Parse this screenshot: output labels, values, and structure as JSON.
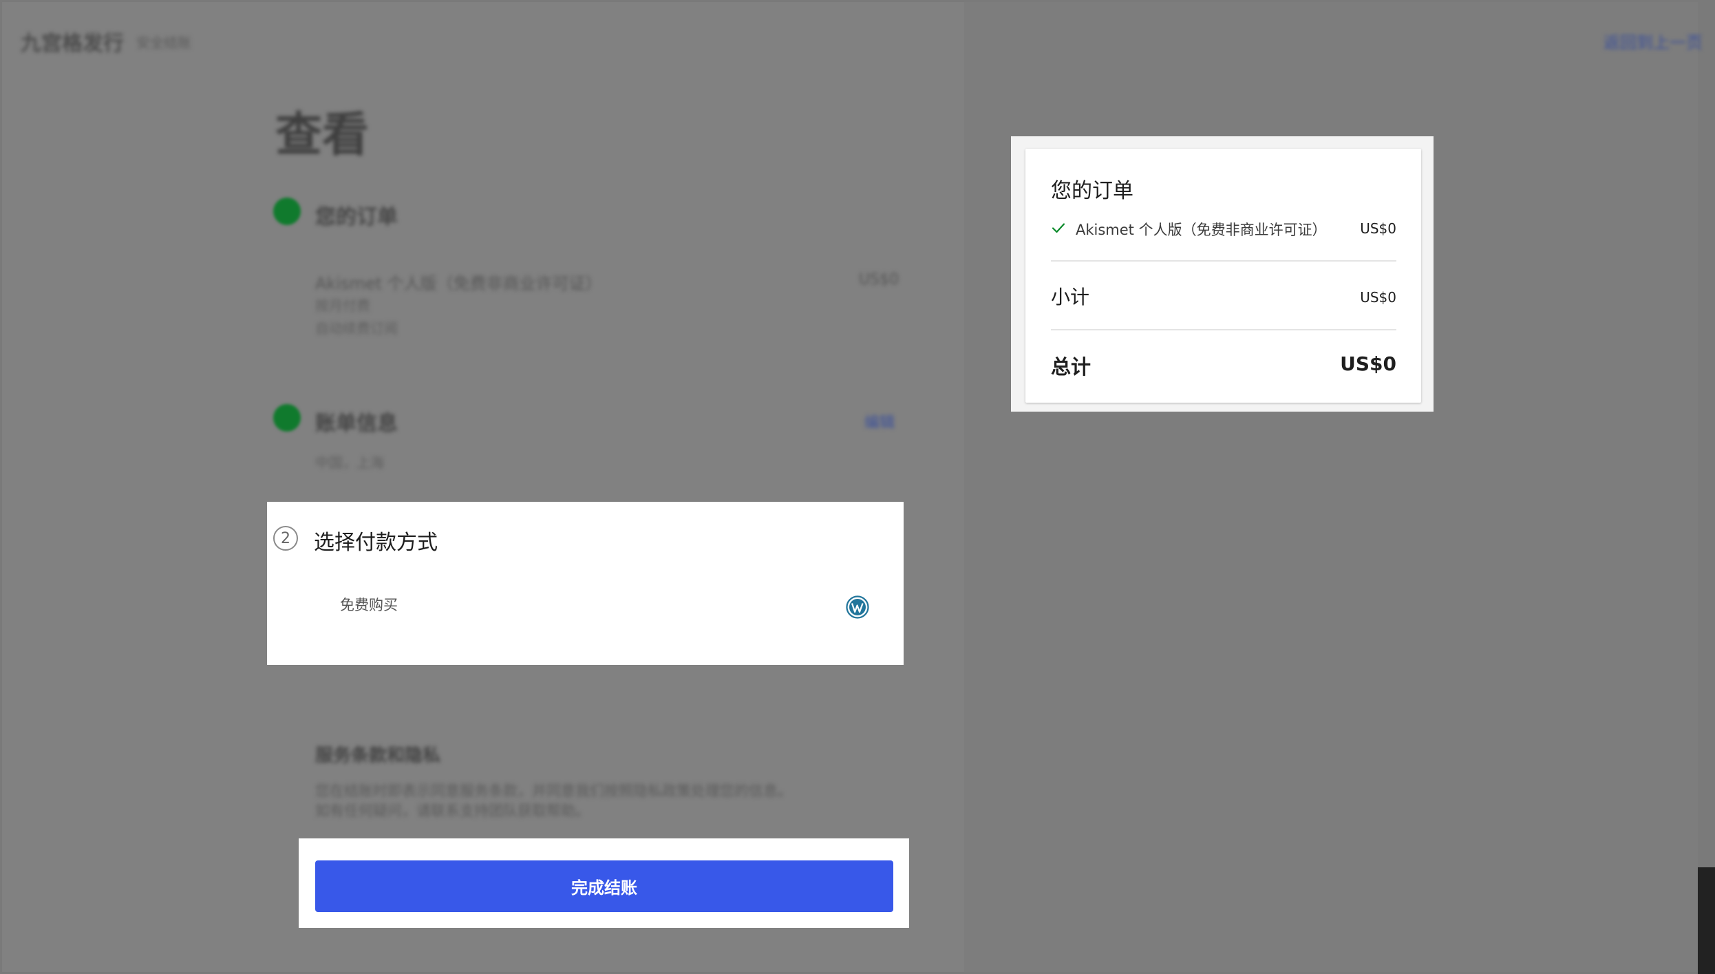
{
  "header": {
    "brand": "九宫格发行",
    "brand_sub": "安全结账",
    "top_link": "返回到上一页"
  },
  "page": {
    "title": "查看"
  },
  "steps": {
    "order": {
      "title": "您的订单",
      "line": "Akismet 个人版（免费非商业许可证）",
      "price": "US$0",
      "meta1": "按月付费",
      "meta2": "自动续费订阅"
    },
    "billing": {
      "title": "账单信息",
      "edit_label": "编辑",
      "meta": "中国，上海"
    },
    "payment": {
      "number": "2",
      "title": "选择付款方式",
      "option_label": "免费购买"
    }
  },
  "terms": {
    "title": "服务条款和隐私",
    "line1": "您在结账时即表示同意服务条款，并同意我们按照隐私政策处理您的信息。",
    "line2": "如有任何疑问，请联系支持团队获取帮助。"
  },
  "checkout": {
    "button_label": "完成结账"
  },
  "summary": {
    "title": "您的订单",
    "item_label": "Akismet 个人版（免费非商业许可证）",
    "item_price": "US$0",
    "subtotal_label": "小计",
    "subtotal_value": "US$0",
    "total_label": "总计",
    "total_value": "US$0"
  },
  "colors": {
    "accent": "#3858e9",
    "success": "#0a8a2a",
    "wordpress": "#21759b"
  },
  "icons": {
    "payment_method": "wordpress-icon",
    "item_check": "check-icon"
  }
}
